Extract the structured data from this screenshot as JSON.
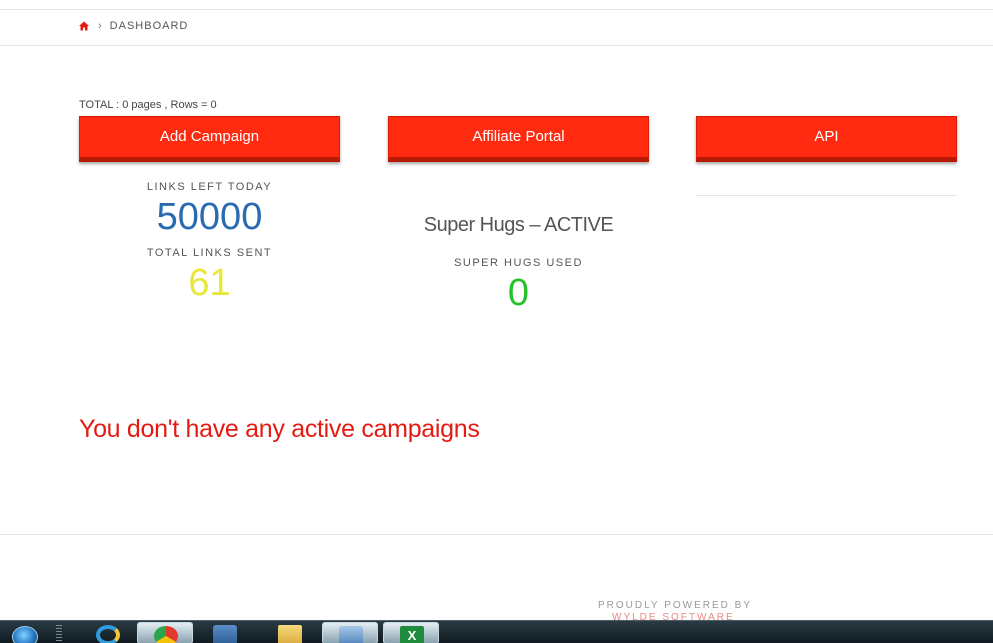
{
  "breadcrumb": {
    "home_icon": "home-icon",
    "separator": "›",
    "current": "DASHBOARD"
  },
  "total_text": "TOTAL : 0 pages , Rows = 0",
  "buttons": {
    "add_campaign": "Add Campaign",
    "affiliate_portal": "Affiliate Portal",
    "api": "API"
  },
  "stats": {
    "links_left_label": "LINKS LEFT TODAY",
    "links_left_value": "50000",
    "total_sent_label": "TOTAL LINKS SENT",
    "total_sent_value": "61",
    "super_hugs_status": "Super Hugs – ACTIVE",
    "super_hugs_used_label": "SUPER HUGS USED",
    "super_hugs_used_value": "0"
  },
  "no_campaigns_message": "You don't have any active campaigns",
  "footer": {
    "powered_by": "PROUDLY POWERED BY",
    "company": "WYLDE SOFTWARE"
  },
  "colors": {
    "accent_red": "#ff2a0f",
    "stat_blue": "#2a6ab0",
    "stat_yellow": "#e8e83a",
    "stat_green": "#27c22a",
    "message_red": "#e41b13"
  },
  "taskbar": {
    "icons": [
      "windows-start-icon",
      "internet-explorer-icon",
      "chrome-icon",
      "media-player-icon",
      "folder-icon",
      "network-icon",
      "excel-icon"
    ]
  }
}
